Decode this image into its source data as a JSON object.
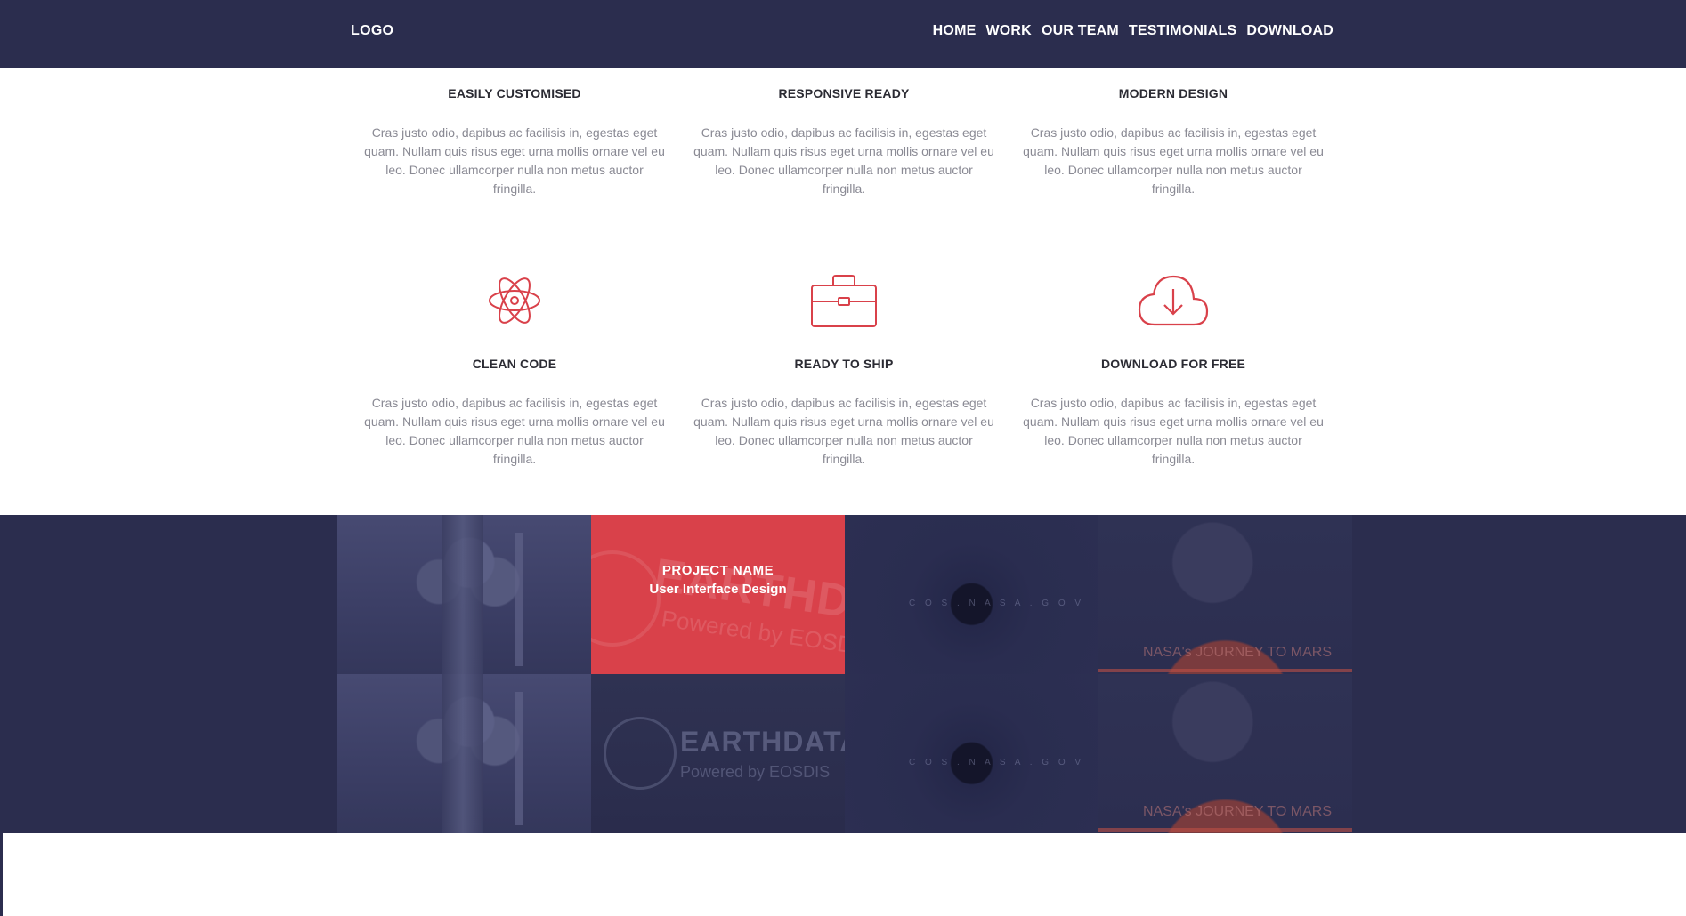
{
  "header": {
    "logo": "LOGO",
    "nav": [
      "HOME",
      "WORK",
      "OUR TEAM",
      "TESTIMONIALS",
      "DOWNLOAD"
    ]
  },
  "features": [
    {
      "title": "EASILY CUSTOMISED",
      "text": "Cras justo odio, dapibus ac facilisis in, egestas eget quam. Nullam quis risus eget urna mollis ornare vel eu leo. Donec ullamcorper nulla non metus auctor fringilla."
    },
    {
      "title": "RESPONSIVE READY",
      "text": "Cras justo odio, dapibus ac facilisis in, egestas eget quam. Nullam quis risus eget urna mollis ornare vel eu leo. Donec ullamcorper nulla non metus auctor fringilla."
    },
    {
      "title": "MODERN DESIGN",
      "text": "Cras justo odio, dapibus ac facilisis in, egestas eget quam. Nullam quis risus eget urna mollis ornare vel eu leo. Donec ullamcorper nulla non metus auctor fringilla."
    },
    {
      "title": "CLEAN CODE",
      "icon": "atom-icon",
      "text": "Cras justo odio, dapibus ac facilisis in, egestas eget quam. Nullam quis risus eget urna mollis ornare vel eu leo. Donec ullamcorper nulla non metus auctor fringilla."
    },
    {
      "title": "READY TO SHIP",
      "icon": "briefcase-icon",
      "text": "Cras justo odio, dapibus ac facilisis in, egestas eget quam. Nullam quis risus eget urna mollis ornare vel eu leo. Donec ullamcorper nulla non metus auctor fringilla."
    },
    {
      "title": "DOWNLOAD FOR FREE",
      "icon": "cloud-download-icon",
      "text": "Cras justo odio, dapibus ac facilisis in, egestas eget quam. Nullam quis risus eget urna mollis ornare vel eu leo. Donec ullamcorper nulla non metus auctor fringilla."
    }
  ],
  "portfolio": {
    "hover_title": "PROJECT NAME",
    "hover_subtitle": "User Interface Design",
    "earthdata_text": "EARTHDATA",
    "earthdata_sub": "Powered by EOSDIS",
    "cosmic_text": "C O S . N A S A . G O V",
    "journey_text": "NASA's JOURNEY TO MARS"
  },
  "colors": {
    "header_bg": "#2b2d4e",
    "accent": "#d9414a",
    "heading": "#2b2b33",
    "body_text": "#8a8a94"
  }
}
